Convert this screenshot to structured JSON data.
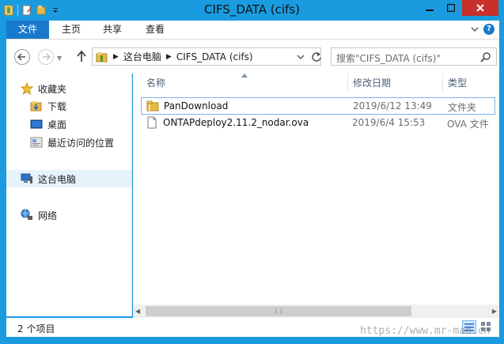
{
  "window": {
    "title": "CIFS_DATA (cifs)"
  },
  "ribbon": {
    "tabs": [
      "文件",
      "主页",
      "共享",
      "查看"
    ]
  },
  "address": {
    "segments": [
      "这台电脑",
      "CIFS_DATA (cifs)"
    ],
    "search_placeholder": "搜索\"CIFS_DATA (cifs)\""
  },
  "nav_pane": {
    "items": [
      {
        "label": "收藏夹",
        "icon": "star-icon"
      },
      {
        "label": "下载",
        "icon": "download-folder-icon"
      },
      {
        "label": "桌面",
        "icon": "desktop-icon"
      },
      {
        "label": "最近访问的位置",
        "icon": "recent-places-icon"
      },
      {
        "label": "这台电脑",
        "icon": "computer-icon"
      },
      {
        "label": "网络",
        "icon": "network-icon"
      }
    ]
  },
  "file_list": {
    "columns": {
      "name": "名称",
      "date": "修改日期",
      "type": "类型"
    },
    "rows": [
      {
        "name": "PanDownload",
        "date": "2019/6/12 13:49",
        "type": "文件夹",
        "icon": "folder-icon"
      },
      {
        "name": "ONTAPdeploy2.11.2_nodar.ova",
        "date": "2019/6/4 15:53",
        "type": "OVA 文件",
        "icon": "file-icon"
      }
    ]
  },
  "status": {
    "item_count": "2 个项目"
  },
  "watermark": "https://www.mr-mao.cn",
  "colors": {
    "titlebar": "#1a9be0",
    "file_tab": "#1979ca",
    "close_button": "#c7302b",
    "selection": "#7eb4ea",
    "folder": "#e8b84a"
  }
}
